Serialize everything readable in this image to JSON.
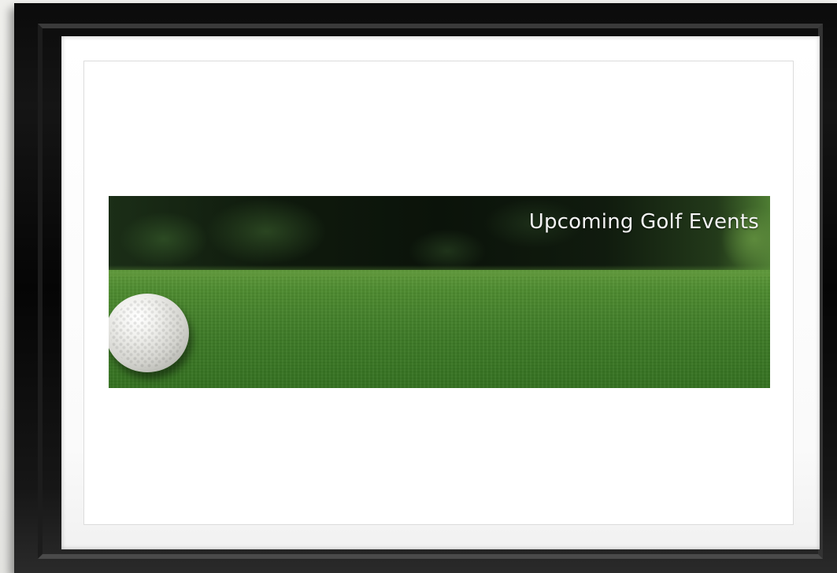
{
  "banner": {
    "title": "Upcoming Golf Events"
  },
  "image": {
    "subject_icons": [
      "golf-ball-icon"
    ]
  }
}
